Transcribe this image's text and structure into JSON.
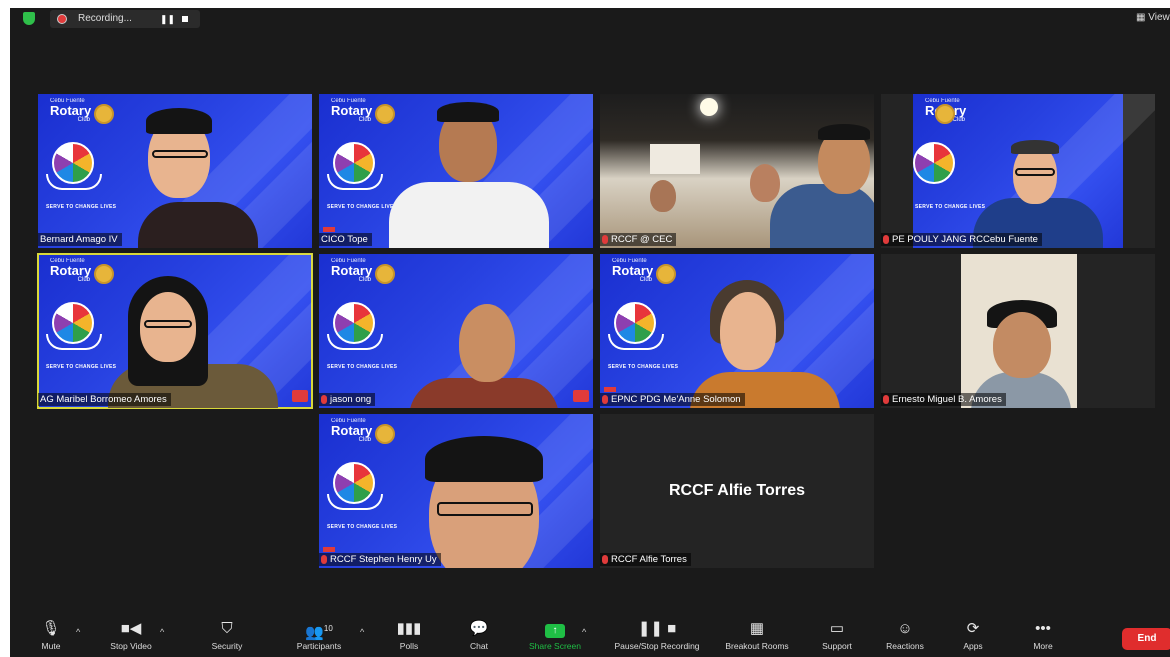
{
  "topbar": {
    "recording_label": "Recording...",
    "pause_icon": "pause-icon",
    "stop_icon": "stop-icon",
    "view_label": "View"
  },
  "tiles": [
    {
      "name": "Bernard Amago IV",
      "muted": false,
      "background": "rotary"
    },
    {
      "name": "CICO Tope",
      "muted": false,
      "background": "rotary"
    },
    {
      "name": "RCCF @ CEC",
      "muted": true,
      "background": "restaurant"
    },
    {
      "name": "PE POULY JANG RCCebu Fuente",
      "muted": true,
      "background": "rotary"
    },
    {
      "name": "AG Maribel Borromeo Amores",
      "muted": false,
      "background": "rotary",
      "active_speaker": true
    },
    {
      "name": "jason ong",
      "muted": true,
      "background": "rotary"
    },
    {
      "name": "EPNC PDG Me'Anne Solomon",
      "muted": true,
      "background": "rotary"
    },
    {
      "name": "Ernesto Miguel B. Amores",
      "muted": true,
      "background": "room"
    },
    {
      "name": "RCCF Stephen Henry Uy",
      "muted": true,
      "background": "rotary"
    },
    {
      "name": "RCCF Alfie Torres",
      "muted": true,
      "background": "none",
      "display_text": "RCCF Alfie Torres"
    }
  ],
  "rotary_bg": {
    "line1": "Cebu Fuente",
    "line2": "Rotary",
    "line3": "Club",
    "tagline": "SERVE TO CHANGE LIVES"
  },
  "toolbar": {
    "participants_count": "10",
    "items": [
      {
        "label": "Mute",
        "icon": "microphone-icon"
      },
      {
        "label": "Stop Video",
        "icon": "video-camera-icon"
      },
      {
        "label": "Security",
        "icon": "shield-icon"
      },
      {
        "label": "Participants",
        "icon": "participants-icon"
      },
      {
        "label": "Polls",
        "icon": "polls-icon"
      },
      {
        "label": "Chat",
        "icon": "chat-icon"
      },
      {
        "label": "Share Screen",
        "icon": "share-screen-icon"
      },
      {
        "label": "Pause/Stop Recording",
        "icon": "recording-icon"
      },
      {
        "label": "Breakout Rooms",
        "icon": "breakout-rooms-icon"
      },
      {
        "label": "Support",
        "icon": "support-icon"
      },
      {
        "label": "Reactions",
        "icon": "reactions-icon"
      },
      {
        "label": "Apps",
        "icon": "apps-icon"
      },
      {
        "label": "More",
        "icon": "more-icon"
      }
    ],
    "end_label": "End"
  },
  "colors": {
    "window_bg": "#1a1a1a",
    "share_green": "#1fbf45",
    "end_red": "#e02d2d",
    "active_speaker_border": "#d8d83a",
    "rotary_blue": "#2741e0"
  }
}
